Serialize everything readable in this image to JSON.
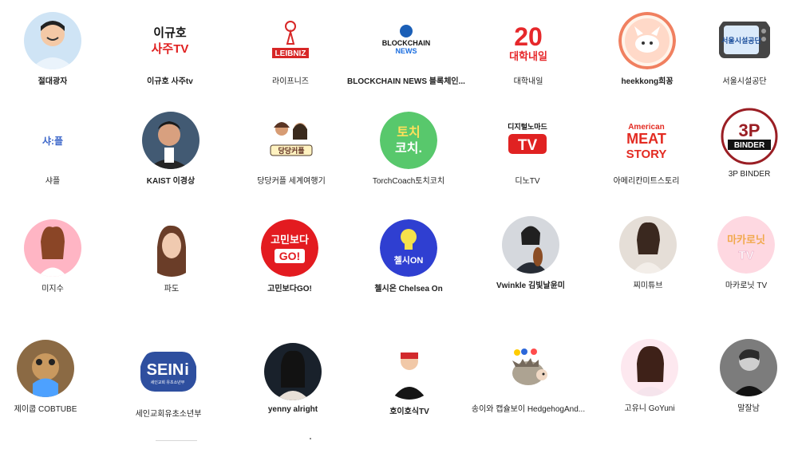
{
  "channels": [
    {
      "name": "절대광자",
      "avatar": "person-icon",
      "logo": ""
    },
    {
      "name": "이규호 사주tv",
      "avatar": "logo-icon",
      "logo": "이규호 사주TV"
    },
    {
      "name": "라이프니즈",
      "avatar": "logo-icon",
      "logo": "LEIBNIZ"
    },
    {
      "name": "BLOCKCHAIN NEWS 블록체인...",
      "avatar": "logo-icon",
      "logo": "BLOCKCHAIN NEWS"
    },
    {
      "name": "대학내일",
      "avatar": "logo-icon",
      "logo": "20 대학내일"
    },
    {
      "name": "heekkong희꽁",
      "avatar": "cartoon-icon",
      "logo": ""
    },
    {
      "name": "서울시설공단",
      "avatar": "tv-icon",
      "logo": "서울시설공단"
    },
    {
      "name": "샤플",
      "avatar": "text-icon",
      "logo": "샤:플"
    },
    {
      "name": "KAIST 이경상",
      "avatar": "person-icon",
      "logo": ""
    },
    {
      "name": "당당커플 세계여행기",
      "avatar": "couple-icon",
      "logo": "당당커플"
    },
    {
      "name": "TorchCoach토치코치",
      "avatar": "logo-icon",
      "logo": "토치 코치."
    },
    {
      "name": "디노TV",
      "avatar": "logo-icon",
      "logo": "TV"
    },
    {
      "name": "아메리칸미트스토리",
      "avatar": "logo-icon",
      "logo": "American MEAT STORY"
    },
    {
      "name": "3P BINDER",
      "avatar": "logo-icon",
      "logo": "3P BINDER"
    },
    {
      "name": "미지수",
      "avatar": "person-icon",
      "logo": ""
    },
    {
      "name": "파도",
      "avatar": "person-icon",
      "logo": ""
    },
    {
      "name": "고민보다GO!",
      "avatar": "logo-icon",
      "logo": "고민보다 GO!"
    },
    {
      "name": "첼시온 Chelsea On",
      "avatar": "logo-icon",
      "logo": "첼시ON"
    },
    {
      "name": "Vwinkle 김빛날윤미",
      "avatar": "person-icon",
      "logo": ""
    },
    {
      "name": "찌미튜브",
      "avatar": "person-icon",
      "logo": ""
    },
    {
      "name": "마카로닛 TV",
      "avatar": "logo-icon",
      "logo": "마카로닛 TV"
    },
    {
      "name": "제이쿱 COBTUBE",
      "avatar": "person-icon",
      "logo": ""
    },
    {
      "name": "세인교회유초소년부",
      "avatar": "logo-icon",
      "logo": "SEIN i"
    },
    {
      "name": "yenny alright",
      "avatar": "person-icon",
      "logo": ""
    },
    {
      "name": "호이호식TV",
      "avatar": "person-icon",
      "logo": "호이호식"
    },
    {
      "name": "송이와 캡슐보이 HedgehogAnd...",
      "avatar": "hedgehog-icon",
      "logo": ""
    },
    {
      "name": "고유니 GoYuni",
      "avatar": "person-icon",
      "logo": ""
    },
    {
      "name": "말잘남",
      "avatar": "person-icon",
      "logo": ""
    }
  ]
}
